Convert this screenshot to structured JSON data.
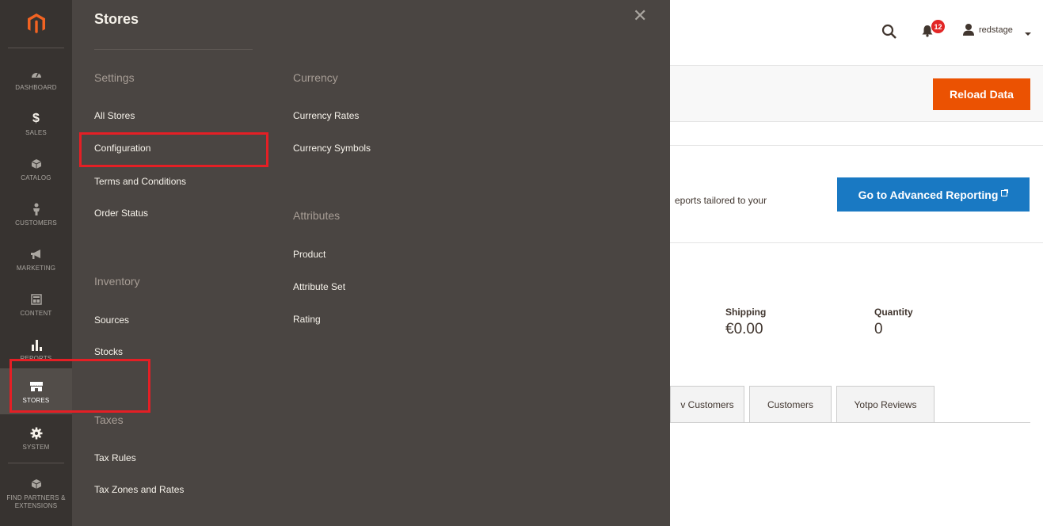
{
  "sidebar": {
    "logo_icon": "magento-logo-icon",
    "items": [
      {
        "label": "DASHBOARD",
        "icon": "dashboard-gauge-icon"
      },
      {
        "label": "SALES",
        "icon": "dollar-icon"
      },
      {
        "label": "CATALOG",
        "icon": "cube-icon"
      },
      {
        "label": "CUSTOMERS",
        "icon": "person-icon"
      },
      {
        "label": "MARKETING",
        "icon": "megaphone-icon"
      },
      {
        "label": "CONTENT",
        "icon": "layout-icon"
      },
      {
        "label": "REPORTS",
        "icon": "bar-chart-icon"
      },
      {
        "label": "STORES",
        "icon": "storefront-icon"
      },
      {
        "label": "SYSTEM",
        "icon": "gear-icon"
      },
      {
        "label": "FIND PARTNERS & EXTENSIONS",
        "icon": "partners-cube-icon"
      }
    ]
  },
  "flyout": {
    "title": "Stores",
    "close_icon": "close-icon",
    "settings": {
      "heading": "Settings",
      "links": [
        "All Stores",
        "Configuration",
        "Terms and Conditions",
        "Order Status"
      ]
    },
    "inventory": {
      "heading": "Inventory",
      "links": [
        "Sources",
        "Stocks"
      ]
    },
    "taxes": {
      "heading": "Taxes",
      "links": [
        "Tax Rules",
        "Tax Zones and Rates"
      ]
    },
    "currency": {
      "heading": "Currency",
      "links": [
        "Currency Rates",
        "Currency Symbols"
      ]
    },
    "attributes": {
      "heading": "Attributes",
      "links": [
        "Product",
        "Attribute Set",
        "Rating"
      ]
    }
  },
  "header": {
    "notification_count": "12",
    "user_name": "redstage",
    "search_icon": "search-icon",
    "bell_icon": "bell-icon",
    "user_icon": "user-icon",
    "dropdown_icon": "caret-down-icon"
  },
  "main": {
    "reload_button": "Reload Data",
    "advanced_text": "eports tailored to your",
    "advanced_button": "Go to Advanced Reporting",
    "stats": [
      {
        "label": "Shipping",
        "value": "€0.00"
      },
      {
        "label": "Quantity",
        "value": "0"
      }
    ],
    "tabs": [
      "v Customers",
      "Customers",
      "Yotpo Reviews"
    ]
  },
  "colors": {
    "sidebar_bg": "#373330",
    "flyout_bg": "#4a4542",
    "highlight": "#e41f25",
    "reload_orange": "#eb5202",
    "advanced_blue": "#1979c3"
  }
}
